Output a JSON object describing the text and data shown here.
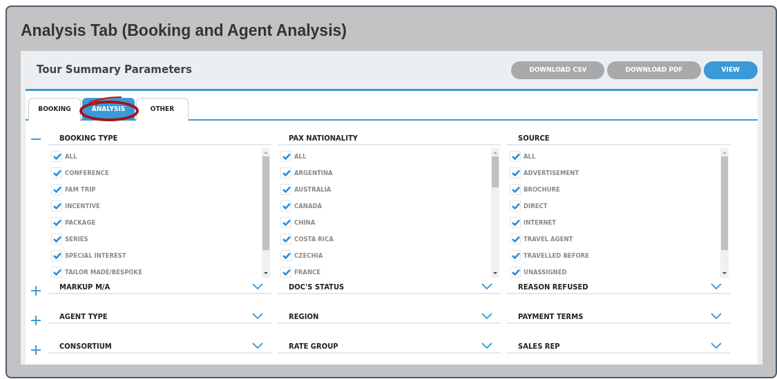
{
  "window": {
    "title": "Analysis Tab (Booking and Agent Analysis)"
  },
  "panel": {
    "title": "Tour Summary Parameters",
    "buttons": [
      {
        "label": "DOWNLOAD CSV",
        "kind": "secondary"
      },
      {
        "label": "DOWNLOAD PDF",
        "kind": "secondary"
      },
      {
        "label": "VIEW",
        "kind": "primary"
      }
    ]
  },
  "tabs": [
    {
      "label": "BOOKING",
      "selected": false,
      "highlighted": false
    },
    {
      "label": "ANALYSIS",
      "selected": true,
      "highlighted": true
    },
    {
      "label": "OTHER",
      "selected": false,
      "highlighted": false
    }
  ],
  "rows": [
    {
      "expanded": true,
      "groups": [
        {
          "title": "BOOKING TYPE",
          "items": [
            {
              "label": "ALL",
              "checked": true
            },
            {
              "label": "CONFERENCE",
              "checked": true
            },
            {
              "label": "FAM TRIP",
              "checked": true
            },
            {
              "label": "INCENTIVE",
              "checked": true
            },
            {
              "label": "PACKAGE",
              "checked": true
            },
            {
              "label": "SERIES",
              "checked": true
            },
            {
              "label": "SPECIAL INTEREST",
              "checked": true
            },
            {
              "label": "TAILOR MADE/BESPOKE",
              "checked": true
            }
          ]
        },
        {
          "title": "PAX NATIONALITY",
          "items": [
            {
              "label": "ALL",
              "checked": true
            },
            {
              "label": "ARGENTINA",
              "checked": true
            },
            {
              "label": "AUSTRALIA",
              "checked": true
            },
            {
              "label": "CANADA",
              "checked": true
            },
            {
              "label": "CHINA",
              "checked": true
            },
            {
              "label": "COSTA RICA",
              "checked": true
            },
            {
              "label": "CZECHIA",
              "checked": true
            },
            {
              "label": "FRANCE",
              "checked": true
            }
          ]
        },
        {
          "title": "SOURCE",
          "items": [
            {
              "label": "ALL",
              "checked": true
            },
            {
              "label": "ADVERTISEMENT",
              "checked": true
            },
            {
              "label": "BROCHURE",
              "checked": true
            },
            {
              "label": "DIRECT",
              "checked": true
            },
            {
              "label": "INTERNET",
              "checked": true
            },
            {
              "label": "TRAVEL AGENT",
              "checked": true
            },
            {
              "label": "TRAVELLED BEFORE",
              "checked": true
            },
            {
              "label": "UNASSIGNED",
              "checked": true
            }
          ]
        }
      ]
    },
    {
      "expanded": false,
      "groups": [
        {
          "title": "MARKUP M/A"
        },
        {
          "title": "DOC'S STATUS"
        },
        {
          "title": "REASON REFUSED"
        }
      ]
    },
    {
      "expanded": false,
      "groups": [
        {
          "title": "AGENT TYPE"
        },
        {
          "title": "REGION"
        },
        {
          "title": "PAYMENT TERMS"
        }
      ]
    },
    {
      "expanded": false,
      "groups": [
        {
          "title": "CONSORTIUM"
        },
        {
          "title": "RATE GROUP"
        },
        {
          "title": "SALES REP"
        }
      ]
    }
  ]
}
